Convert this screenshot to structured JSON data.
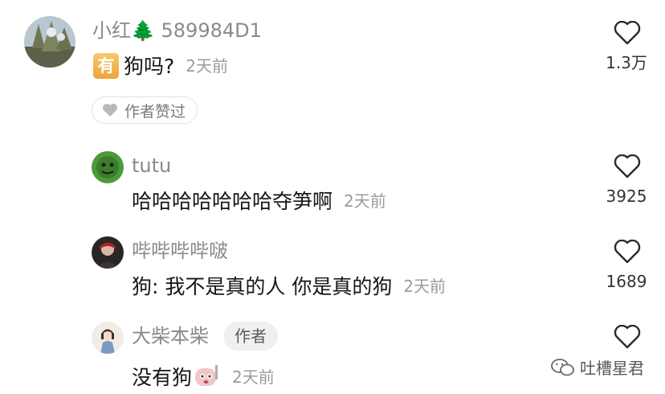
{
  "comments": [
    {
      "username": "小红🌲 589984D1",
      "badge": "有",
      "text": "狗吗?",
      "time": "2天前",
      "likes": "1.3万",
      "author_liked": "作者赞过",
      "avatar_icon": "tree-photo-avatar"
    },
    {
      "username": "tutu",
      "text": "哈哈哈哈哈哈哈夺笋啊",
      "time": "2天前",
      "likes": "3925",
      "avatar_icon": "green-character-avatar"
    },
    {
      "username": "哔哔哔哔啵",
      "text": "狗:  我不是真的人 你是真的狗",
      "time": "2天前",
      "likes": "1689",
      "avatar_icon": "dark-portrait-avatar"
    },
    {
      "username": "大柴本柴",
      "author_tag": "作者",
      "text": "没有狗",
      "time": "2天前",
      "avatar_icon": "girl-illustration-avatar"
    }
  ],
  "watermark": {
    "text": "吐槽星君",
    "icon": "wechat-icon"
  },
  "colors": {
    "username": "#8a8a8a",
    "comment_text": "#161616",
    "time": "#9b9b9b",
    "badge": "#f0b24a"
  }
}
